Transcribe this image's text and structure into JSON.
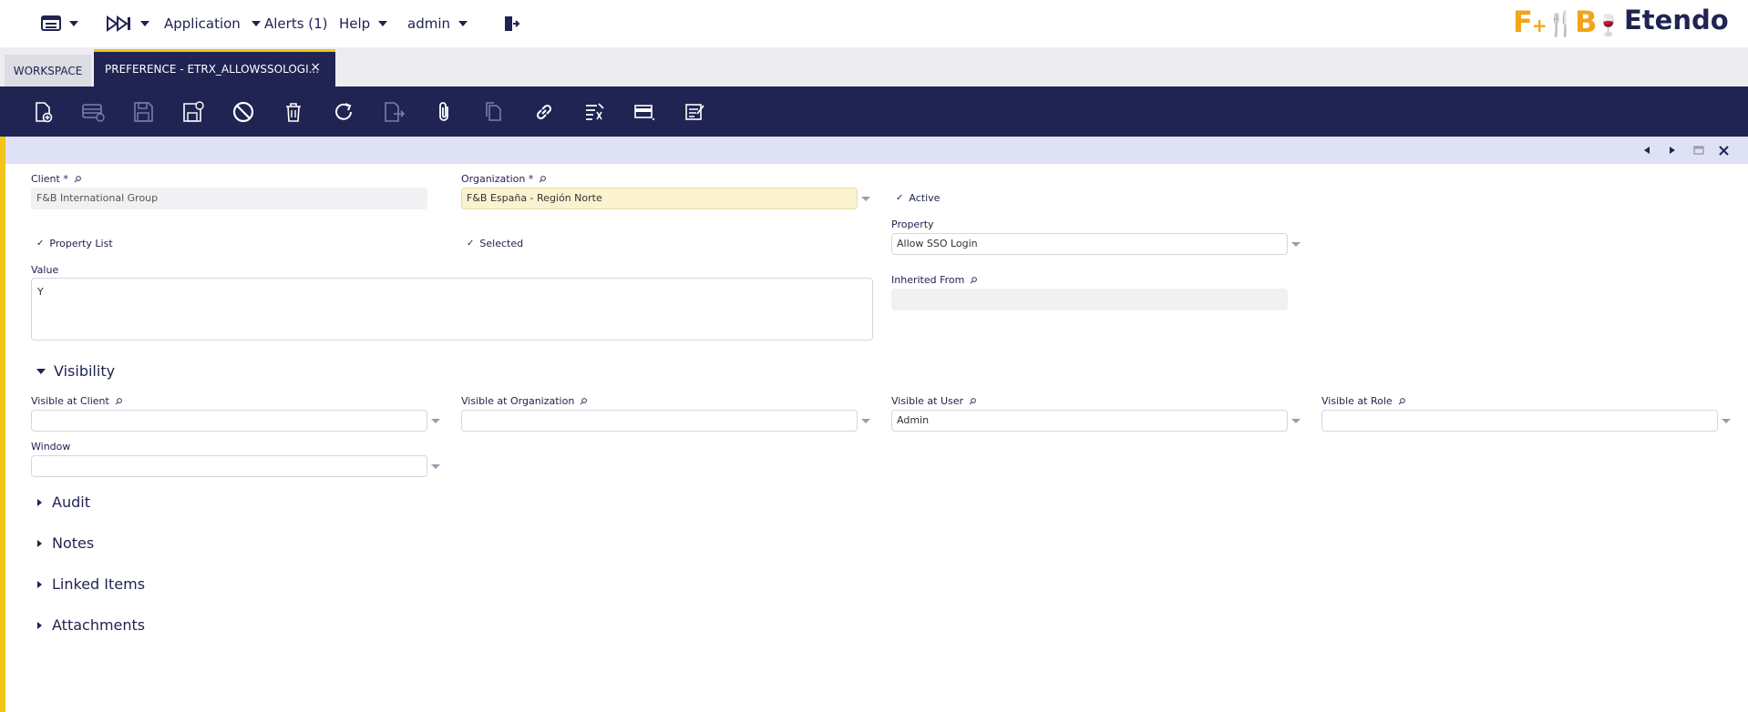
{
  "nav": {
    "application": "Application",
    "alerts": "Alerts (1)",
    "help": "Help",
    "user": "admin"
  },
  "logos": {
    "fb_left": "F",
    "fb_mid": "+",
    "fb_right": "B",
    "etendo": "Etendo"
  },
  "tabs": {
    "workspace": "WORKSPACE",
    "active": "PREFERENCE - ETRX_ALLOWSSOLOGI...",
    "close": "×"
  },
  "toolbar": {
    "icons": [
      "new-record-icon",
      "new-row-icon",
      "save-icon",
      "save-close-icon",
      "undo-icon",
      "delete-icon",
      "refresh-icon",
      "export-icon",
      "attach-icon",
      "copy-icon",
      "link-icon",
      "process-icon",
      "grid-view-icon",
      "notes-icon"
    ]
  },
  "form": {
    "client_label": "Client *",
    "client_value": "F&B International Group",
    "organization_label": "Organization *",
    "organization_value": "F&B España - Región Norte",
    "active_label": "Active",
    "property_list_label": "Property List",
    "selected_label": "Selected",
    "property_label": "Property",
    "property_value": "Allow SSO Login",
    "value_label": "Value",
    "value_value": "Y",
    "inherited_from_label": "Inherited From",
    "inherited_from_value": ""
  },
  "visibility": {
    "title": "Visibility",
    "client_label": "Visible at Client",
    "client_value": "",
    "organization_label": "Visible at Organization",
    "organization_value": "",
    "user_label": "Visible at User",
    "user_value": "Admin",
    "role_label": "Visible at Role",
    "role_value": "",
    "window_label": "Window",
    "window_value": ""
  },
  "sections": {
    "audit": "Audit",
    "notes": "Notes",
    "linked_items": "Linked Items",
    "attachments": "Attachments"
  },
  "colors": {
    "navy": "#202452",
    "accent": "#f2c318",
    "status_bar": "#dfe1f4",
    "mandatory_bg": "#fbf3d0"
  }
}
